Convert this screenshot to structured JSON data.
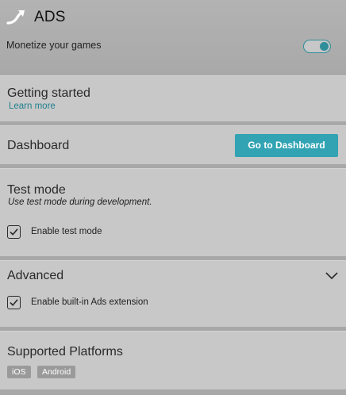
{
  "header": {
    "icon": "arrow-swoosh-icon",
    "title": "ADS",
    "subtitle": "Monetize your games",
    "toggle_on": true
  },
  "getting_started": {
    "title": "Getting started",
    "link": "Learn more"
  },
  "dashboard": {
    "title": "Dashboard",
    "button_label": "Go to Dashboard"
  },
  "test_mode": {
    "title": "Test mode",
    "note": "Use test mode during development.",
    "checkbox_label": "Enable test mode",
    "checked": true
  },
  "advanced": {
    "title": "Advanced",
    "checkbox_label": "Enable built-in Ads extension",
    "checked": true,
    "expand_icon": "chevron-down-icon"
  },
  "platforms": {
    "title": "Supported Platforms",
    "tags": [
      "iOS",
      "Android"
    ]
  },
  "colors": {
    "accent": "#31a3b3",
    "link": "#1f7f8f",
    "section_bg": "#c8c8c8",
    "divider": "#a8a8a8"
  }
}
